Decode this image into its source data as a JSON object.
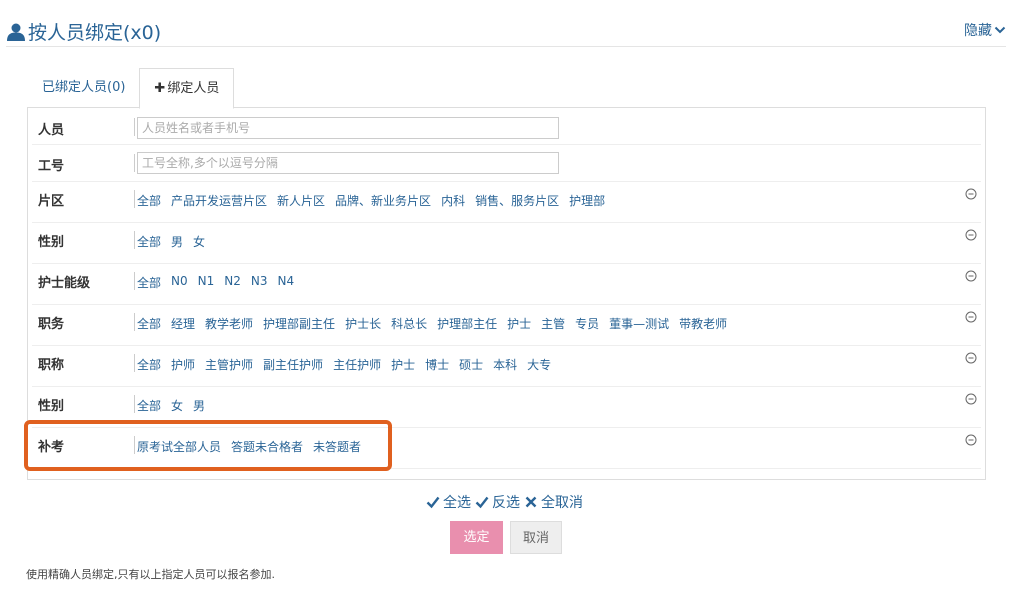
{
  "header": {
    "title": "按人员绑定(x0)",
    "hide_label": "隐藏"
  },
  "tabs": [
    {
      "label": "已绑定人员(0)"
    },
    {
      "label": "绑定人员"
    }
  ],
  "filters": {
    "person": {
      "label": "人员",
      "placeholder": "人员姓名或者手机号"
    },
    "employee_no": {
      "label": "工号",
      "placeholder": "工号全称,多个以逗号分隔"
    },
    "area": {
      "label": "片区",
      "options": [
        "全部",
        "产品开发运营片区",
        "新人片区",
        "品牌、新业务片区",
        "内科",
        "销售、服务片区",
        "护理部"
      ]
    },
    "gender": {
      "label": "性别",
      "options": [
        "全部",
        "男",
        "女"
      ]
    },
    "nurse_level": {
      "label": "护士能级",
      "options": [
        "全部",
        "N0",
        "N1",
        "N2",
        "N3",
        "N4"
      ]
    },
    "position": {
      "label": "职务",
      "options": [
        "全部",
        "经理",
        "教学老师",
        "护理部副主任",
        "护士长",
        "科总长",
        "护理部主任",
        "护士",
        "主管",
        "专员",
        "董事—测试",
        "带教老师"
      ]
    },
    "title": {
      "label": "职称",
      "options": [
        "全部",
        "护师",
        "主管护师",
        "副主任护师",
        "主任护师",
        "护士",
        "博士",
        "硕士",
        "本科",
        "大专"
      ]
    },
    "gender2": {
      "label": "性别",
      "options": [
        "全部",
        "女",
        "男"
      ]
    },
    "retake": {
      "label": "补考",
      "options": [
        "原考试全部人员",
        "答题未合格者",
        "未答题者"
      ]
    }
  },
  "actions": {
    "select_all": "全选",
    "invert": "反选",
    "deselect_all": "全取消"
  },
  "buttons": {
    "confirm": "选定",
    "cancel": "取消"
  },
  "footer_note": "使用精确人员绑定,只有以上指定人员可以报名参加.",
  "colors": {
    "link": "#2a6496",
    "confirm_bg": "#e98fae",
    "highlight": "#e0601f"
  }
}
